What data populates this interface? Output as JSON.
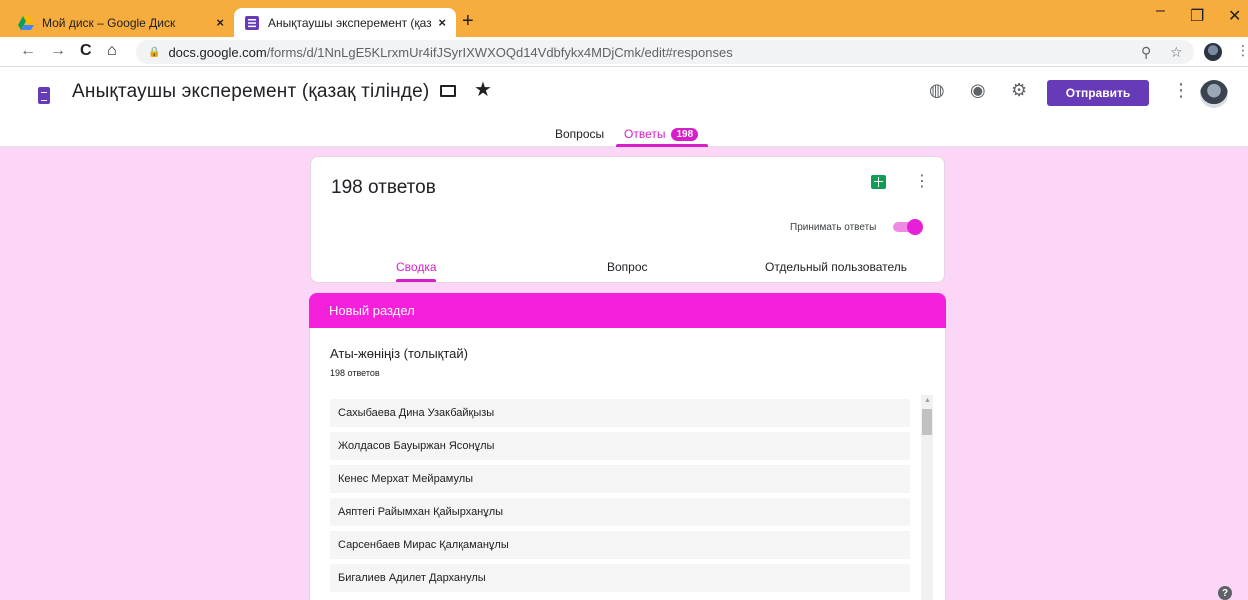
{
  "browser": {
    "tabs": [
      {
        "title": "Мой диск – Google Диск",
        "close": "×"
      },
      {
        "title": "Анықтаушы эксперемент (қазақ",
        "close": "×"
      }
    ],
    "new_tab": "+",
    "url_host": "docs.google.com",
    "url_path": "/forms/d/1NnLgE5KLrxmUr4ifJSyrIXWXOQd14Vdbfykx4MDjCmk/edit#responses",
    "icons": [
      "back-icon",
      "forward-icon",
      "reload-icon",
      "home-icon",
      "lock-icon",
      "zoom-icon",
      "bookmark-star-icon",
      "profile-icon",
      "menu-icon"
    ]
  },
  "header": {
    "title": "Анықтаушы эксперемент (қазақ тілінде)",
    "send_label": "Отправить",
    "icons": [
      "palette-icon",
      "preview-eye-icon",
      "settings-gear-icon",
      "more-vert-icon"
    ],
    "accent_color": "#673ab7"
  },
  "nav": {
    "questions_label": "Вопросы",
    "responses_label": "Ответы",
    "responses_count": "198",
    "active_color": "#d61fc8"
  },
  "summary": {
    "response_count": "198 ответов",
    "accept_label": "Принимать ответы",
    "accepting": true,
    "tabs": [
      "Сводка",
      "Вопрос",
      "Отдельный пользователь"
    ],
    "active_tab": "Сводка"
  },
  "section": {
    "title": "Новый раздел",
    "color": "#f520dc"
  },
  "question": {
    "title": "Аты-жөніңіз (толықтай)",
    "count": "198 ответов",
    "answers": [
      "Сахыбаева Дина Узакбайқызы",
      "Жолдасов Бауыржан Ясонұлы",
      "Кенес Мерхат Мейрамулы",
      "Аяптегі Райымхан Қайырханұлы",
      "Сарсенбаев Мирас Қалқаманұлы",
      "Бигалиев Адилет Дарханулы"
    ]
  },
  "page": {
    "background": "#fbd6f6",
    "help": "?"
  }
}
